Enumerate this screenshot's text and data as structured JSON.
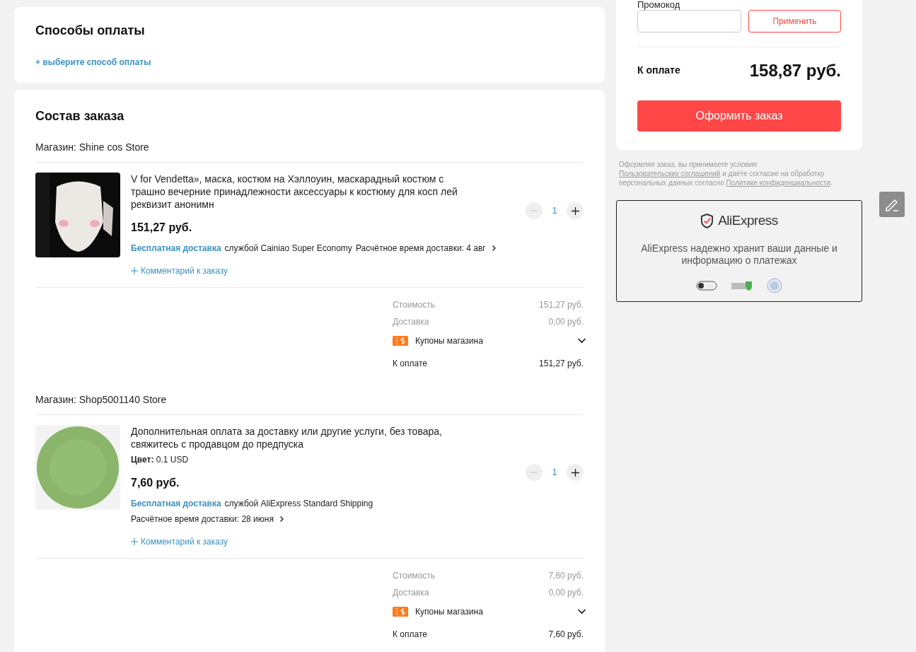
{
  "payment": {
    "title": "Способы оплаты",
    "action": "+ выберите способ оплаты"
  },
  "order": {
    "title": "Состав заказа",
    "stores": [
      {
        "store": "Магазин: Shine cos Store",
        "item": {
          "title": "V for Vendetta», маска, костюм на Хэллоуин, маскарадный костюм с трашно вечерние принадлежности аксессуары к костюму для косп лей реквизит анонимн",
          "price": "151,27 руб.",
          "free": "Бесплатная доставка",
          "service": "службой Cainiao Super Economy",
          "eta": "Расчётное время доставки: 4 авг",
          "comment": "Комментарий к заказу",
          "qty": "1",
          "decrease_disabled": true
        },
        "cost": {
          "label": "Стоимость",
          "value": "151,27 руб."
        },
        "shipping": {
          "label": "Доставка",
          "value": "0,00 руб."
        },
        "coupons": "Купоны магазина",
        "total": {
          "label": "К оплате",
          "value": "151,27 руб."
        }
      },
      {
        "store": "Магазин: Shop5001140 Store",
        "item": {
          "title": "Дополнительная оплата за доставку или другие услуги, без товара, свяжитесь с продавцом до предпуска",
          "option": "**Цвет:** 0.1 USD",
          "price": "7,60 руб.",
          "free": "Бесплатная доставка",
          "service": "службой AliExpress Standard Shipping",
          "eta": "Расчётное время доставки: 28 июня",
          "comment": "Комментарий к заказу",
          "qty": "1",
          "decrease_disabled": true
        },
        "cost": {
          "label": "Стоимость",
          "value": "7,60 руб."
        },
        "shipping": {
          "label": "Доставка",
          "value": "0,00 руб."
        },
        "coupons": "Купоны магазина",
        "total": {
          "label": "К оплате",
          "value": "7,60 руб."
        }
      }
    ]
  },
  "summary": {
    "promo_label": "Промокод",
    "apply": "Применить",
    "total_label": "К оплате",
    "total": "158,87 руб.",
    "checkout": "Оформить заказ"
  },
  "terms": {
    "before": "Оформляя заказ, вы принимаете условия",
    "link1": "Пользовательских соглашений",
    "middle": "и даёте согласие на обработку персональных данных согласно",
    "link2": "Политике конфиденциальности",
    "end": "."
  },
  "security": {
    "brand": "AliExpress",
    "text": "AliExpress надежно хранит ваши данные и информацию о платежах"
  }
}
